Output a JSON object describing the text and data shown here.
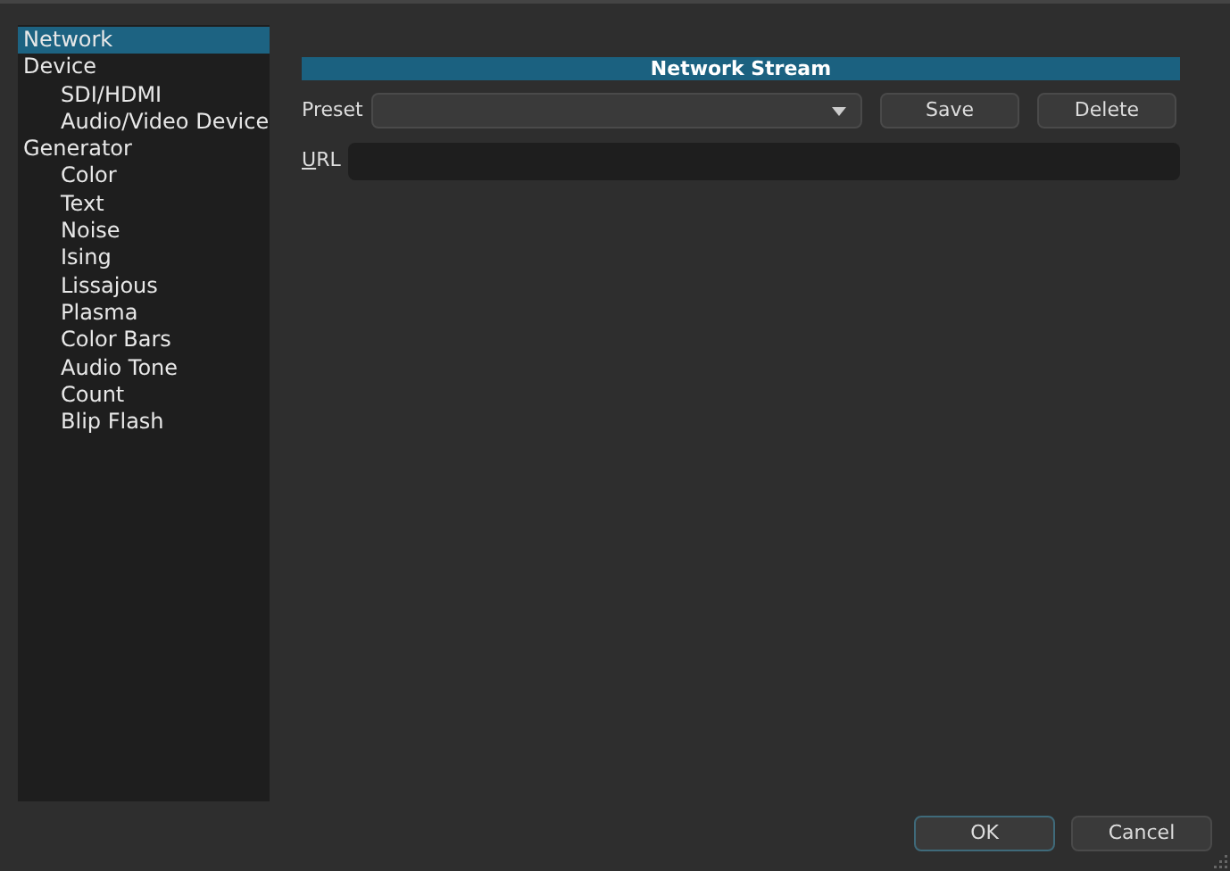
{
  "sidebar": {
    "items": [
      {
        "label": "Network",
        "selected": true
      },
      {
        "label": "Device",
        "selected": false,
        "children": [
          {
            "label": "SDI/HDMI",
            "selected": false
          },
          {
            "label": "Audio/Video Device",
            "selected": false
          }
        ]
      },
      {
        "label": "Generator",
        "selected": false,
        "children": [
          {
            "label": "Color",
            "selected": false
          },
          {
            "label": "Text",
            "selected": false
          },
          {
            "label": "Noise",
            "selected": false
          },
          {
            "label": "Ising",
            "selected": false
          },
          {
            "label": "Lissajous",
            "selected": false
          },
          {
            "label": "Plasma",
            "selected": false
          },
          {
            "label": "Color Bars",
            "selected": false
          },
          {
            "label": "Audio Tone",
            "selected": false
          },
          {
            "label": "Count",
            "selected": false
          },
          {
            "label": "Blip Flash",
            "selected": false
          }
        ]
      }
    ]
  },
  "panel": {
    "title": "Network Stream",
    "preset": {
      "label": "Preset",
      "buttons": [
        "Save",
        "Delete"
      ]
    },
    "url": {
      "label": "URL"
    }
  },
  "buttons": [
    {
      "label": "OK",
      "default": true
    },
    {
      "label": "Cancel",
      "default": false
    }
  ]
}
